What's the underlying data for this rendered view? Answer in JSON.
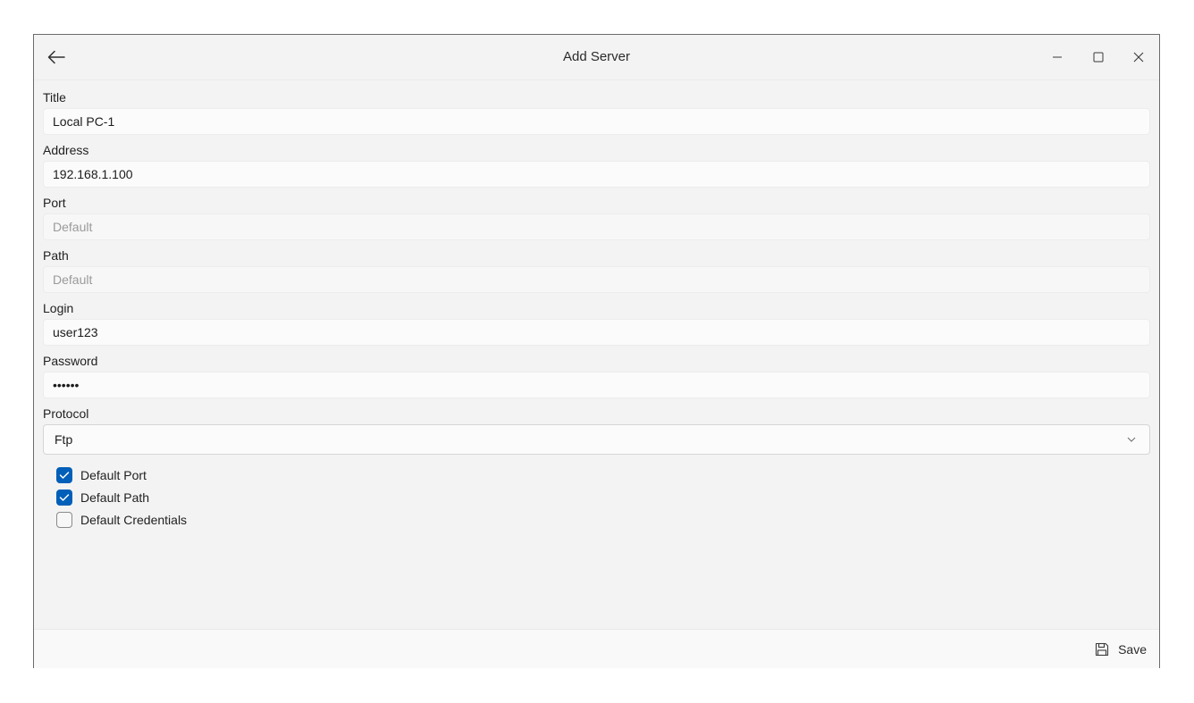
{
  "window": {
    "title": "Add Server"
  },
  "form": {
    "title": {
      "label": "Title",
      "value": "Local PC-1"
    },
    "address": {
      "label": "Address",
      "value": "192.168.1.100"
    },
    "port": {
      "label": "Port",
      "placeholder": "Default"
    },
    "path": {
      "label": "Path",
      "placeholder": "Default"
    },
    "login": {
      "label": "Login",
      "value": "user123"
    },
    "password": {
      "label": "Password",
      "value": "••••••"
    },
    "protocol": {
      "label": "Protocol",
      "selected": "Ftp"
    }
  },
  "options": [
    {
      "label": "Default Port",
      "checked": true
    },
    {
      "label": "Default Path",
      "checked": true
    },
    {
      "label": "Default Credentials",
      "checked": false
    }
  ],
  "footer": {
    "save_label": "Save"
  },
  "colors": {
    "accent": "#005fb8",
    "background": "#f3f3f3"
  },
  "icons": {
    "back": "back-arrow-icon",
    "minimize": "minimize-icon",
    "maximize": "maximize-icon",
    "close": "close-icon",
    "chevron": "chevron-down-icon",
    "save": "floppy-disk-icon",
    "check": "checkmark-icon"
  }
}
